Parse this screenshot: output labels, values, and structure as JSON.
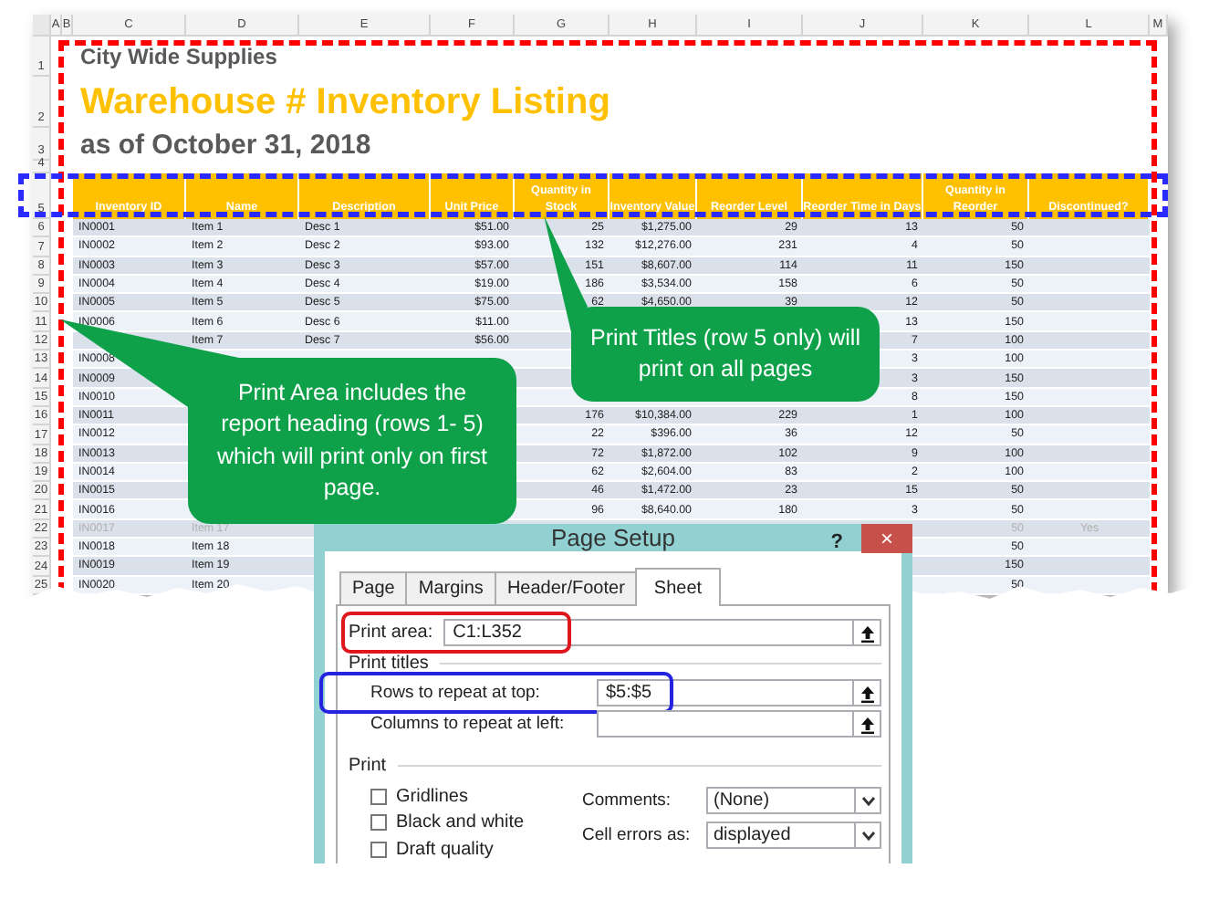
{
  "sheet": {
    "column_letters": [
      "A",
      "B",
      "C",
      "D",
      "E",
      "F",
      "G",
      "H",
      "I",
      "J",
      "K",
      "L",
      "M"
    ],
    "report_rows": [
      {
        "row_number": "1",
        "kind": "company",
        "text": "City Wide Supplies"
      },
      {
        "row_number": "2",
        "kind": "title",
        "text": "Warehouse # Inventory Listing"
      },
      {
        "row_number": "3",
        "kind": "subtitle",
        "text": "as of October 31, 2018"
      },
      {
        "row_number": "4",
        "kind": "spacer"
      }
    ],
    "header_row_number": "5",
    "columns": [
      "Inventory ID",
      "Name",
      "Description",
      "Unit Price",
      "Quantity in Stock",
      "Inventory Value",
      "Reorder Level",
      "Reorder Time in Days",
      "Quantity in Reorder",
      "Discontinued?"
    ],
    "rows": [
      {
        "row_number": "6",
        "greyed": false,
        "cells": [
          "IN0001",
          "Item 1",
          "Desc 1",
          "$51.00",
          "25",
          "$1,275.00",
          "29",
          "13",
          "50",
          null
        ]
      },
      {
        "row_number": "7",
        "greyed": false,
        "cells": [
          "IN0002",
          "Item 2",
          "Desc 2",
          "$93.00",
          "132",
          "$12,276.00",
          "231",
          "4",
          "50",
          null
        ]
      },
      {
        "row_number": "8",
        "greyed": false,
        "cells": [
          "IN0003",
          "Item 3",
          "Desc 3",
          "$57.00",
          "151",
          "$8,607.00",
          "114",
          "11",
          "150",
          null
        ]
      },
      {
        "row_number": "9",
        "greyed": false,
        "cells": [
          "IN0004",
          "Item 4",
          "Desc 4",
          "$19.00",
          "186",
          "$3,534.00",
          "158",
          "6",
          "50",
          null
        ]
      },
      {
        "row_number": "10",
        "greyed": false,
        "cells": [
          "IN0005",
          "Item 5",
          "Desc 5",
          "$75.00",
          "62",
          "$4,650.00",
          "39",
          "12",
          "50",
          null
        ]
      },
      {
        "row_number": "11",
        "greyed": false,
        "cells": [
          "IN0006",
          "Item 6",
          "Desc 6",
          "$11.00",
          null,
          null,
          null,
          "13",
          "150",
          null
        ]
      },
      {
        "row_number": "12",
        "greyed": false,
        "cells": [
          null,
          "Item 7",
          "Desc 7",
          "$56.00",
          null,
          null,
          null,
          "7",
          "100",
          null
        ]
      },
      {
        "row_number": "13",
        "greyed": false,
        "cells": [
          "IN0008",
          null,
          null,
          null,
          null,
          null,
          null,
          "3",
          "100",
          null
        ]
      },
      {
        "row_number": "14",
        "greyed": false,
        "cells": [
          "IN0009",
          null,
          null,
          null,
          null,
          null,
          null,
          "3",
          "150",
          null
        ]
      },
      {
        "row_number": "15",
        "greyed": false,
        "cells": [
          "IN0010",
          null,
          null,
          null,
          null,
          null,
          null,
          "8",
          "150",
          null
        ]
      },
      {
        "row_number": "16",
        "greyed": false,
        "cells": [
          "IN0011",
          null,
          null,
          null,
          "176",
          "$10,384.00",
          "229",
          "1",
          "100",
          null
        ]
      },
      {
        "row_number": "17",
        "greyed": false,
        "cells": [
          "IN0012",
          null,
          null,
          null,
          "22",
          "$396.00",
          "36",
          "12",
          "50",
          null
        ]
      },
      {
        "row_number": "18",
        "greyed": false,
        "cells": [
          "IN0013",
          null,
          null,
          null,
          "72",
          "$1,872.00",
          "102",
          "9",
          "100",
          null
        ]
      },
      {
        "row_number": "19",
        "greyed": false,
        "cells": [
          "IN0014",
          null,
          null,
          null,
          "62",
          "$2,604.00",
          "83",
          "2",
          "100",
          null
        ]
      },
      {
        "row_number": "20",
        "greyed": false,
        "cells": [
          "IN0015",
          null,
          null,
          null,
          "46",
          "$1,472.00",
          "23",
          "15",
          "50",
          null
        ]
      },
      {
        "row_number": "21",
        "greyed": false,
        "cells": [
          "IN0016",
          null,
          null,
          null,
          "96",
          "$8,640.00",
          "180",
          "3",
          "50",
          null
        ]
      },
      {
        "row_number": "22",
        "greyed": true,
        "cells": [
          "IN0017",
          "Item 17",
          null,
          null,
          null,
          null,
          null,
          null,
          "50",
          "Yes"
        ]
      },
      {
        "row_number": "23",
        "greyed": false,
        "cells": [
          "IN0018",
          "Item 18",
          null,
          null,
          null,
          null,
          null,
          null,
          "50",
          null
        ]
      },
      {
        "row_number": "24",
        "greyed": false,
        "cells": [
          "IN0019",
          "Item 19",
          null,
          null,
          null,
          null,
          null,
          null,
          "150",
          null
        ]
      },
      {
        "row_number": "25",
        "greyed": false,
        "cells": [
          "IN0020",
          "Item 20",
          null,
          null,
          null,
          null,
          null,
          null,
          "50",
          null
        ]
      }
    ]
  },
  "callouts": [
    {
      "kind": "print-area",
      "text": "Print Area includes the report heading (rows 1- 5) which will print only on first page."
    },
    {
      "kind": "print-titles",
      "text": "Print Titles (row 5 only) will print on all pages"
    }
  ],
  "dialog": {
    "title": "Page Setup",
    "help": "?",
    "close": "×",
    "tabs": [
      {
        "label": "Page",
        "selected": false
      },
      {
        "label": "Margins",
        "selected": false
      },
      {
        "label": "Header/Footer",
        "selected": false
      },
      {
        "label": "Sheet",
        "selected": true
      }
    ],
    "print_area": {
      "label": "Print area:",
      "value": "C1:L352"
    },
    "print_titles_heading": "Print titles",
    "rows_to_repeat": {
      "label": "Rows to repeat at top:",
      "value": "$5:$5"
    },
    "columns_to_repeat": {
      "label": "Columns to repeat at left:"
    },
    "print_heading": "Print",
    "checkboxes": [
      {
        "label": "Gridlines",
        "checked": false
      },
      {
        "label": "Black and white",
        "checked": false
      },
      {
        "label": "Draft quality",
        "checked": false
      }
    ],
    "dropdowns": [
      {
        "label": "Comments:",
        "value": "(None)"
      },
      {
        "label": "Cell errors as:",
        "value": "displayed"
      }
    ]
  }
}
